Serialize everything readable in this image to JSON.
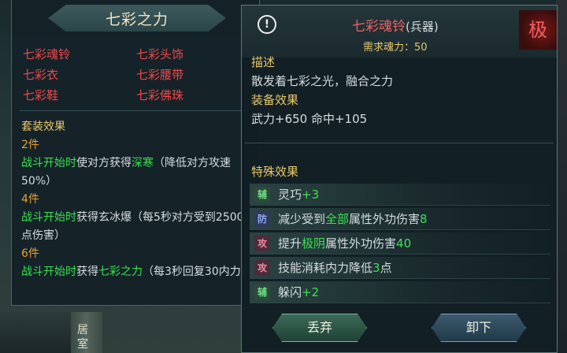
{
  "set_panel": {
    "title": "七彩之力",
    "pieces": [
      "七彩魂铃",
      "七彩头饰",
      "七彩衣",
      "七彩腰带",
      "七彩鞋",
      "七彩佛珠"
    ],
    "bonus_heading": "套装效果",
    "tiers": [
      {
        "label": "2件",
        "trigger": "战斗开始时",
        "text_a": "使对方获得",
        "effect": "深寒",
        "text_b": "（降低对方攻速50%）"
      },
      {
        "label": "4件",
        "trigger": "战斗开始时",
        "text_a": "获得玄冰爆（每5秒对方受到2500点伤害）",
        "effect": "",
        "text_b": ""
      },
      {
        "label": "6件",
        "trigger": "战斗开始时",
        "text_a": "获得",
        "effect": "七彩之力",
        "text_b": "（每3秒回复30内力）"
      }
    ]
  },
  "item_panel": {
    "info_icon": "!",
    "name": "七彩魂铃",
    "type": "(兵器)",
    "grade": "极",
    "requirement": "需求魂力：50",
    "desc_heading": "描述",
    "desc_text": "散发着七彩之光，融合之力",
    "equip_heading": "装备效果",
    "equip_text": "武力+650  命中+105",
    "special_heading": "特殊效果",
    "special": [
      {
        "tag": "辅",
        "tag_kind": "fu",
        "pre": "灵巧",
        "hl": "+3",
        "mid": "",
        "hl2": "",
        "post": ""
      },
      {
        "tag": "防",
        "tag_kind": "fang",
        "pre": "减少受到",
        "hl": "全部",
        "mid": "属性外功伤害",
        "hl2": "8",
        "post": ""
      },
      {
        "tag": "攻",
        "tag_kind": "gong",
        "pre": "提升",
        "hl": "极阴",
        "mid": "属性外功伤害",
        "hl2": "40",
        "post": ""
      },
      {
        "tag": "攻",
        "tag_kind": "gong",
        "pre": "技能消耗内力降低",
        "hl": "3",
        "mid": "点",
        "hl2": "",
        "post": ""
      },
      {
        "tag": "辅",
        "tag_kind": "fu",
        "pre": "躲闪",
        "hl": "+2",
        "mid": "",
        "hl2": "",
        "post": ""
      }
    ],
    "buttons": {
      "discard": "丢弃",
      "unequip": "卸下"
    }
  },
  "background": {
    "pillar_text": "居室"
  },
  "colors": {
    "item_name": "#f06060",
    "set_piece": "#f04848",
    "heading": "#e8c86a",
    "highlight": "#3ce050"
  }
}
